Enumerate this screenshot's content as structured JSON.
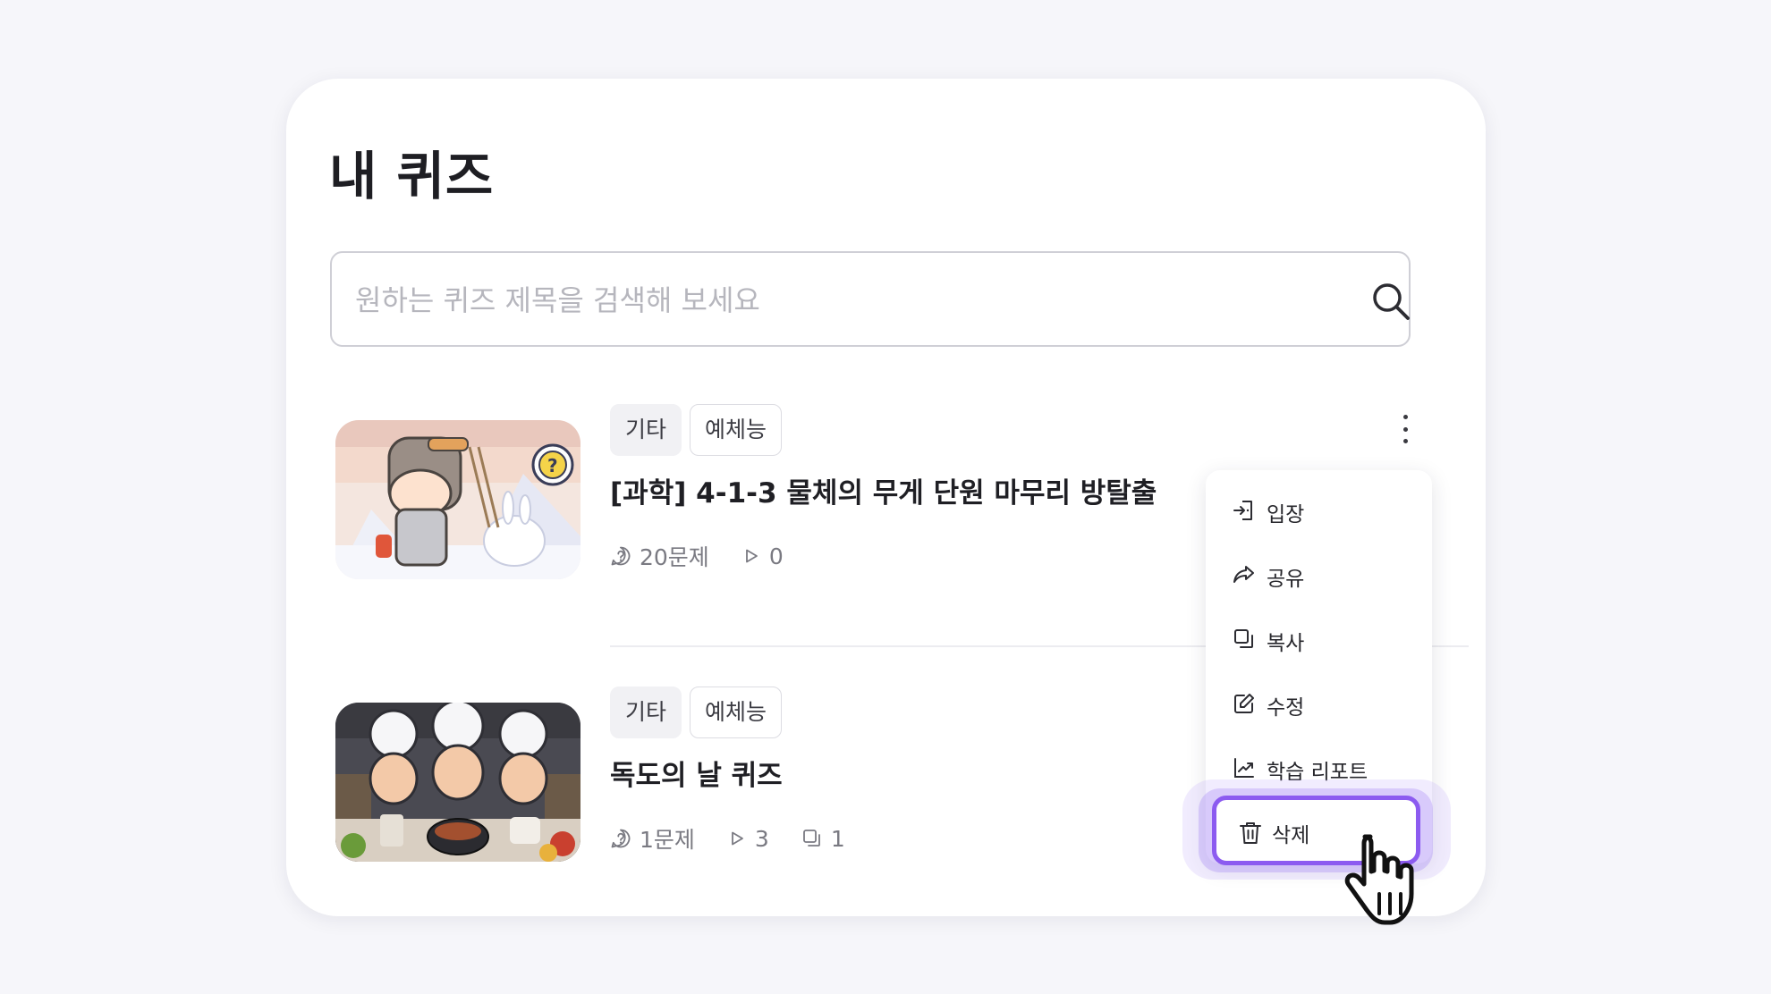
{
  "page": {
    "title": "내 퀴즈"
  },
  "search": {
    "placeholder": "원하는 퀴즈 제목을 검색해 보세요"
  },
  "quizzes": [
    {
      "tags": [
        "기타",
        "예체능"
      ],
      "title": "[과학] 4-1-3 물체의 무게 단원 마무리 방탈출",
      "questions": "20문제",
      "plays": "0"
    },
    {
      "tags": [
        "기타",
        "예체능"
      ],
      "title": "독도의 날 퀴즈",
      "questions": "1문제",
      "plays": "3",
      "copies": "1"
    }
  ],
  "context_menu": {
    "items": [
      {
        "label": "입장",
        "icon": "enter-icon"
      },
      {
        "label": "공유",
        "icon": "share-icon"
      },
      {
        "label": "복사",
        "icon": "copy-icon"
      },
      {
        "label": "수정",
        "icon": "edit-icon"
      },
      {
        "label": "학습 리포트",
        "icon": "report-icon"
      },
      {
        "label": "삭제",
        "icon": "trash-icon"
      }
    ]
  },
  "colors": {
    "accent": "#8c5bf0",
    "background": "#f6f6fa",
    "card": "#ffffff"
  }
}
